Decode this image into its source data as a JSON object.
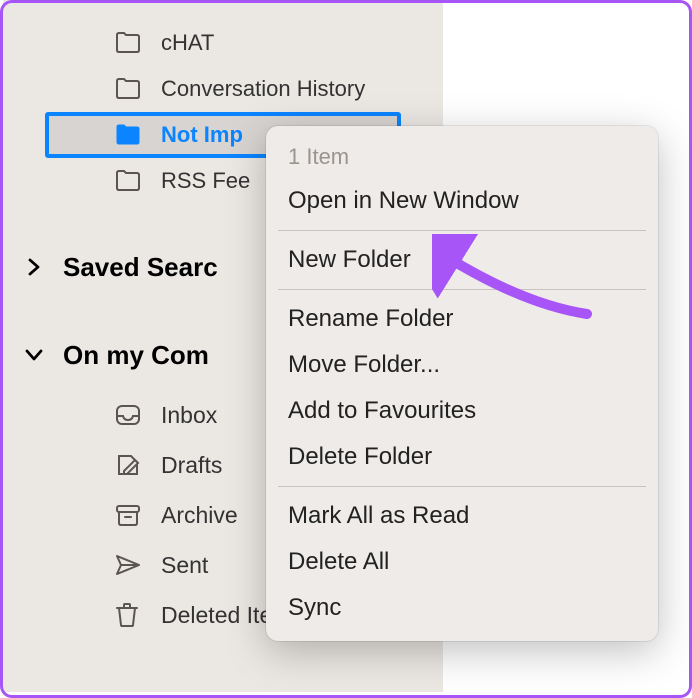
{
  "folders": [
    {
      "label": "cHAT",
      "icon": "folder"
    },
    {
      "label": "Conversation History",
      "icon": "folder"
    },
    {
      "label": "Not Imp",
      "icon": "folder-filled",
      "selected": true
    },
    {
      "label": "RSS Fee",
      "icon": "folder"
    }
  ],
  "sections": {
    "saved": {
      "label": "Saved Searc",
      "expanded": false
    },
    "computer": {
      "label": "On my Com",
      "expanded": true
    }
  },
  "computer_items": [
    {
      "label": "Inbox",
      "icon": "inbox"
    },
    {
      "label": "Drafts",
      "icon": "drafts"
    },
    {
      "label": "Archive",
      "icon": "archive"
    },
    {
      "label": "Sent",
      "icon": "sent"
    },
    {
      "label": "Deleted Items",
      "icon": "trash"
    }
  ],
  "context_menu": {
    "header": "1 Item",
    "groups": [
      [
        "Open in New Window"
      ],
      [
        "New Folder"
      ],
      [
        "Rename Folder",
        "Move Folder...",
        "Add to Favourites",
        "Delete Folder"
      ],
      [
        "Mark All as Read",
        "Delete All",
        "Sync"
      ]
    ]
  },
  "annotation": {
    "arrow_color": "#a855f7"
  }
}
